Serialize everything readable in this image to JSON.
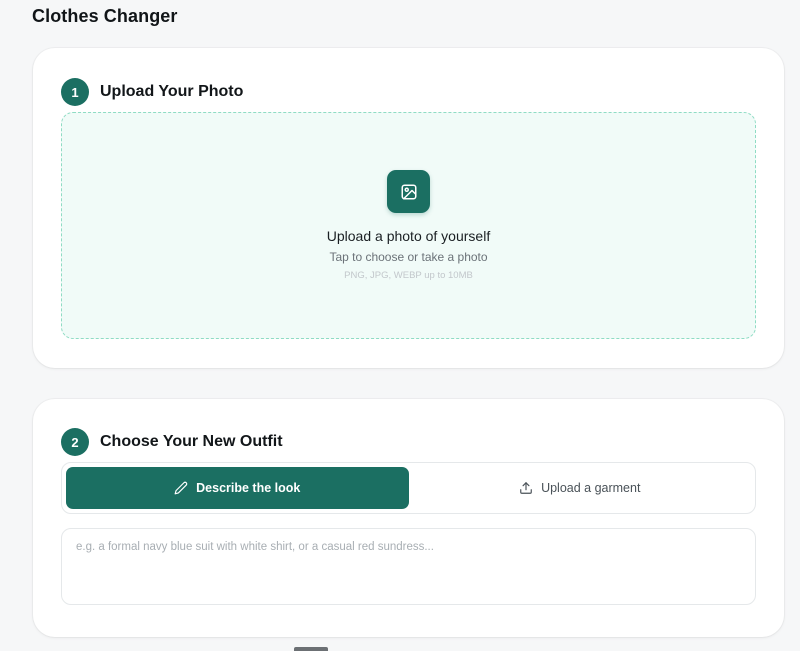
{
  "app": {
    "title": "Clothes Changer"
  },
  "step1": {
    "number": "1",
    "title": "Upload Your Photo",
    "dropzone": {
      "icon": "image-icon",
      "title": "Upload a photo of yourself",
      "subtitle": "Tap to choose or take a photo",
      "hint": "PNG, JPG, WEBP up to 10MB"
    }
  },
  "step2": {
    "number": "2",
    "title": "Choose Your New Outfit",
    "tabs": [
      {
        "label": "Describe the look",
        "icon": "pencil-icon",
        "active": true
      },
      {
        "label": "Upload a garment",
        "icon": "upload-icon",
        "active": false
      }
    ],
    "textarea": {
      "value": "",
      "placeholder": "e.g. a formal navy blue suit with white shirt, or a casual red sundress..."
    }
  },
  "colors": {
    "accent": "#1b6f62",
    "dropzone_bg": "#f1fbf8",
    "dropzone_border": "#8fdcc4"
  }
}
